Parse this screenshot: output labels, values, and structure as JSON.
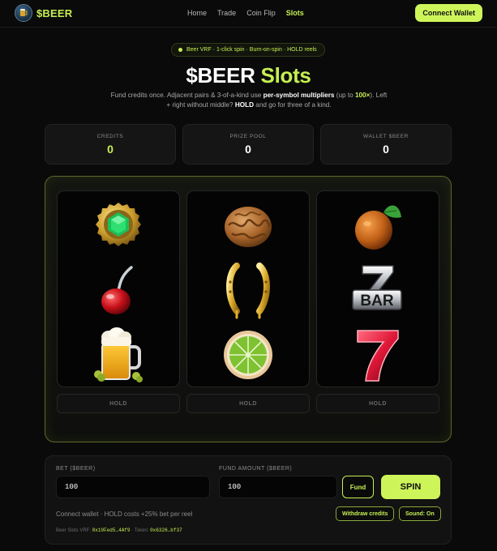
{
  "nav": {
    "brand": "$BEER",
    "links": [
      {
        "label": "Home",
        "active": false
      },
      {
        "label": "Trade",
        "active": false
      },
      {
        "label": "Coin Flip",
        "active": false
      },
      {
        "label": "Slots",
        "active": true
      }
    ],
    "connect_label": "Connect Wallet"
  },
  "hero": {
    "pill": "Beer VRF · 1-click spin · Burn-on-spin · HOLD reels",
    "title_main": "$BEER",
    "title_accent": "Slots",
    "subtitle_1": "Fund credits once. Adjacent pairs & 3-of-a-kind use ",
    "subtitle_bold": "per-symbol multipliers",
    "subtitle_2": " (up to ",
    "subtitle_max": "100×",
    "subtitle_3": "). Left + right without middle? ",
    "subtitle_hold": "HOLD",
    "subtitle_4": " and go for three of a kind."
  },
  "stats": [
    {
      "label": "CREDITS",
      "value": "0"
    },
    {
      "label": "PRIZE POOL",
      "value": "0"
    },
    {
      "label": "WALLET $BEER",
      "value": "0"
    }
  ],
  "reels": [
    {
      "symbols": [
        "bottle-cap-emerald",
        "cherry",
        "beer-mug"
      ],
      "hold_label": "HOLD"
    },
    {
      "symbols": [
        "walnut",
        "golden-horseshoe",
        "lime-slice"
      ],
      "hold_label": "HOLD"
    },
    {
      "symbols": [
        "orange-fruit",
        "bar-seven",
        "red-seven"
      ],
      "hold_label": "HOLD"
    }
  ],
  "bar_text": "BAR",
  "controls": {
    "bet_label": "BET ($BEER)",
    "bet_value": "100",
    "fund_label": "FUND AMOUNT ($BEER)",
    "fund_value": "100",
    "fund_button": "Fund",
    "spin_button": "SPIN",
    "note": "Connect wallet · HOLD costs +25% bet per reel",
    "withdraw_button": "Withdraw credits",
    "sound_button": "Sound: On",
    "vrf_label": "Beer Slots VRF:",
    "vrf_address": "0x19Fed5…4Af9",
    "token_label": "· Token:",
    "token_address": "0x6326…bf37"
  },
  "colors": {
    "accent": "#c6ef52",
    "background": "#0a0a0a",
    "panel": "#151515"
  }
}
